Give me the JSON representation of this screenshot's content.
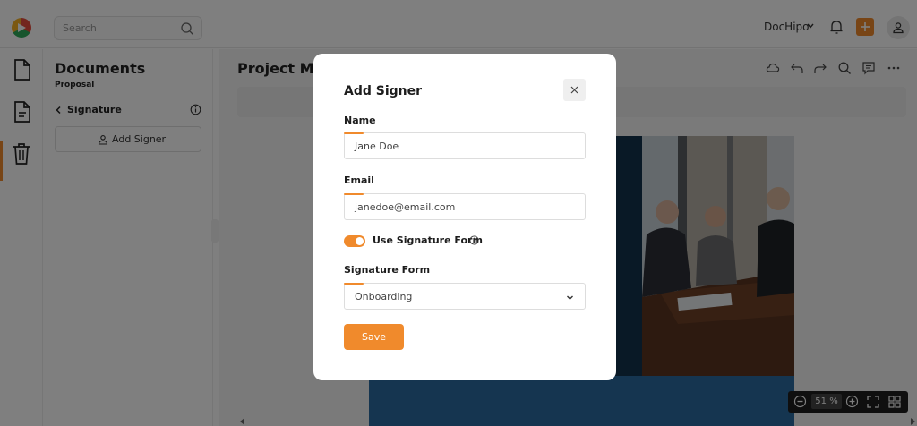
{
  "topbar": {
    "search_placeholder": "Search",
    "brand_label": "DocHipo",
    "accent_color": "#f08a2c"
  },
  "rail": {
    "items": [
      {
        "icon": "document-icon"
      },
      {
        "icon": "file-text-icon",
        "active": true
      },
      {
        "icon": "trash-icon"
      }
    ]
  },
  "panel": {
    "title": "Documents",
    "subtitle": "Proposal",
    "section_label": "Signature",
    "add_signer_label": "Add Signer"
  },
  "workspace": {
    "doc_title": "Project Ma",
    "zoom_value": "51 %"
  },
  "modal": {
    "title": "Add Signer",
    "name_label": "Name",
    "name_value": "Jane Doe",
    "email_label": "Email",
    "email_value": "janedoe@email.com",
    "toggle_label": "Use Signature Form",
    "toggle_on": true,
    "form_label": "Signature Form",
    "form_value": "Onboarding",
    "save_label": "Save"
  }
}
